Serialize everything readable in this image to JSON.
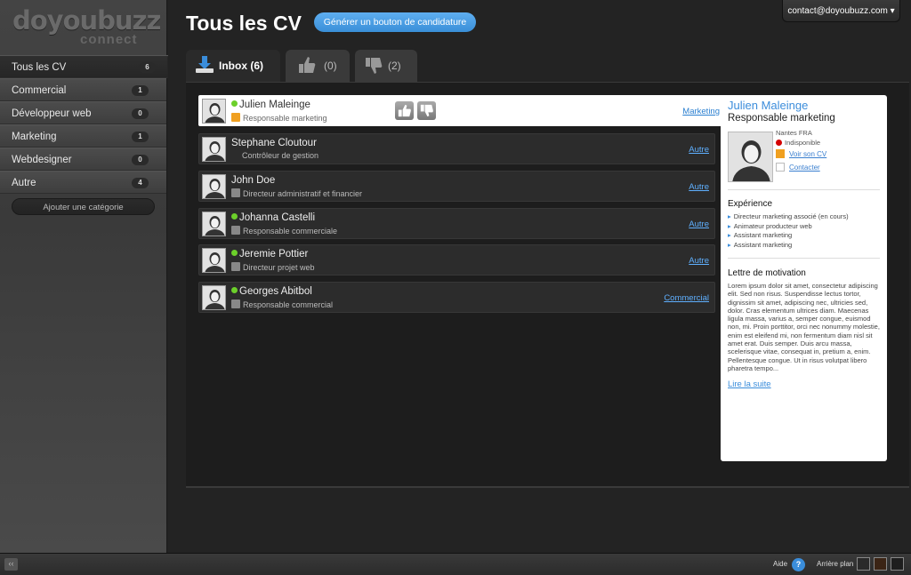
{
  "brand": {
    "logo": "doyoubuzz",
    "sub": "connect"
  },
  "user": {
    "email": "contact@doyoubuzz.com ▾"
  },
  "page": {
    "title": "Tous les CV",
    "generate_button": "Générer un bouton de candidature"
  },
  "sidebar": {
    "items": [
      {
        "label": "Tous les CV",
        "count": "6",
        "active": true
      },
      {
        "label": "Commercial",
        "count": "1"
      },
      {
        "label": "Développeur web",
        "count": "0"
      },
      {
        "label": "Marketing",
        "count": "1"
      },
      {
        "label": "Webdesigner",
        "count": "0"
      },
      {
        "label": "Autre",
        "count": "4"
      }
    ],
    "add_category": "Ajouter une catégorie"
  },
  "tabs": [
    {
      "label": "Inbox (6)",
      "icon": "download-icon",
      "active": true
    },
    {
      "label": "(0)",
      "icon": "thumbs-up-icon"
    },
    {
      "label": "(2)",
      "icon": "thumbs-down-icon"
    }
  ],
  "candidates": [
    {
      "name": "Julien Maleinge",
      "job": "Responsable marketing",
      "tag": "Marketing",
      "online": true,
      "selected": true
    },
    {
      "name": "Stephane Cloutour",
      "job": "Contrôleur de gestion",
      "tag": "Autre",
      "online": false
    },
    {
      "name": "John Doe",
      "job": "Directeur administratif et financier",
      "tag": "Autre",
      "online": false
    },
    {
      "name": "Johanna Castelli",
      "job": "Responsable commerciale",
      "tag": "Autre",
      "online": true
    },
    {
      "name": "Jeremie Pottier",
      "job": "Directeur projet web",
      "tag": "Autre",
      "online": true
    },
    {
      "name": "Georges Abitbol",
      "job": "Responsable commercial",
      "tag": "Commercial",
      "online": true
    }
  ],
  "detail": {
    "name": "Julien Maleinge",
    "job": "Responsable marketing",
    "location": "Nantes FRA",
    "availability": "Indisponible",
    "view_cv": "Voir son CV",
    "contact": "Contacter",
    "experience_title": "Expérience",
    "experience": [
      "Directeur marketing associé (en cours)",
      "Animateur producteur web",
      "Assistant marketing",
      "Assistant marketing"
    ],
    "letter_title": "Lettre de motivation",
    "letter": "Lorem ipsum dolor sit amet, consectetur adipiscing elit. Sed non risus. Suspendisse lectus tortor, dignissim sit amet, adipiscing nec, ultricies sed, dolor. Cras elementum ultrices diam. Maecenas ligula massa, varius a, semper congue, euismod non, mi. Proin porttitor, orci nec nonummy molestie, enim est eleifend mi, non fermentum diam nisl sit amet erat. Duis semper. Duis arcu massa, scelerisque vitae, consequat in, pretium a, enim. Pellentesque congue. Ut in risus volutpat libero pharetra tempo...",
    "read_more": "Lire la suite"
  },
  "footer": {
    "collapse": "‹‹",
    "help": "Aide",
    "help_icon": "?",
    "background": "Arrière plan",
    "swatches": [
      "#2a2a2a",
      "#3b2415",
      "#1e1e1e"
    ]
  },
  "colors": {
    "accent": "#3a8ddb",
    "online": "#6cd02a",
    "unavailable": "#d40000"
  }
}
